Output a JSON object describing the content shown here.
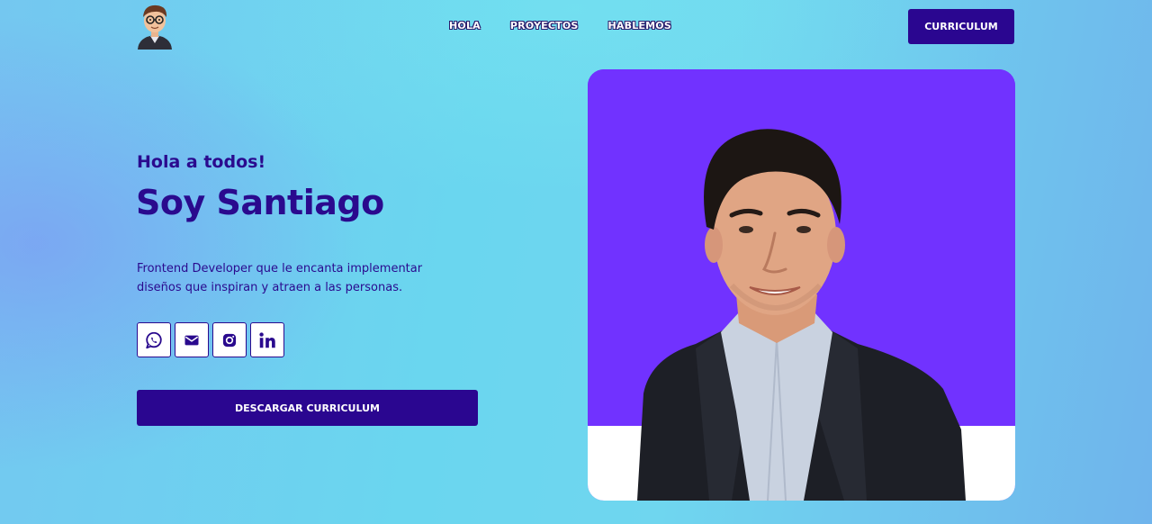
{
  "nav": {
    "logo_icon": "developer-avatar-icon",
    "links": [
      {
        "label": "HOLA"
      },
      {
        "label": "PROYECTOS"
      },
      {
        "label": "HABLEMOS"
      }
    ],
    "cv_button_label": "CURRICULUM"
  },
  "hero": {
    "greeting": "Hola a todos!",
    "name": "Soy Santiago",
    "description": "Frontend Developer que le encanta implementar diseños que inspiran y atraen a las personas.",
    "socials": [
      {
        "icon": "whatsapp-icon"
      },
      {
        "icon": "mail-icon"
      },
      {
        "icon": "instagram-icon"
      },
      {
        "icon": "linkedin-icon"
      }
    ],
    "download_button_label": "DESCARGAR CURRICULUM"
  },
  "photo": {
    "subject": "portrait-photo",
    "background_color": "#7132ff"
  },
  "colors": {
    "primary": "#2a0690",
    "text": "#2a0a8e",
    "accent_purple": "#7132ff",
    "white": "#ffffff"
  }
}
